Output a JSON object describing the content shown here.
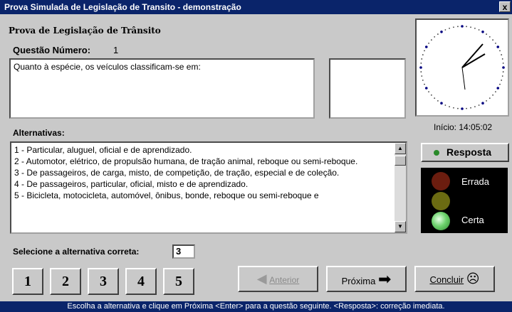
{
  "window": {
    "title": "Prova Simulada de Legislação de Transito - demonstração",
    "close": "x"
  },
  "header": {
    "subtitle": "Prova de Legislação de Trânsito"
  },
  "question": {
    "label": "Questão Número:",
    "number": "1",
    "text": "Quanto à espécie, os veículos classificam-se em:"
  },
  "clock": {
    "start_label": "Início: 14:05:02"
  },
  "alternatives": {
    "label": "Alternativas:",
    "items": [
      "1 - Particular, aluguel, oficial e de aprendizado.",
      "2 - Automotor, elétrico, de propulsão humana, de tração animal, reboque ou semi-reboque.",
      "3 - De passageiros, de carga, misto, de competição, de tração, especial e de coleção.",
      "4 - De passageiros, particular, oficial, misto e de aprendizado.",
      "5 - Bicicleta, motocicleta, automóvel, ônibus, bonde, reboque ou semi-reboque e"
    ]
  },
  "resposta_button": "Resposta",
  "traffic": {
    "wrong": "Errada",
    "right": "Certa",
    "colors": {
      "red": "#6b1d0f",
      "yellow": "#6b6b12",
      "green": "#8be08b"
    }
  },
  "answer": {
    "label": "Selecione a alternativa correta:",
    "value": "3"
  },
  "number_buttons": [
    "1",
    "2",
    "3",
    "4",
    "5"
  ],
  "nav": {
    "prev": "Anterior",
    "next": "Próxima",
    "finish": "Concluir"
  },
  "status": "Escolha a alternativa e clique em Próxima <Enter> para a questão seguinte.   <Resposta>: correção imediata."
}
